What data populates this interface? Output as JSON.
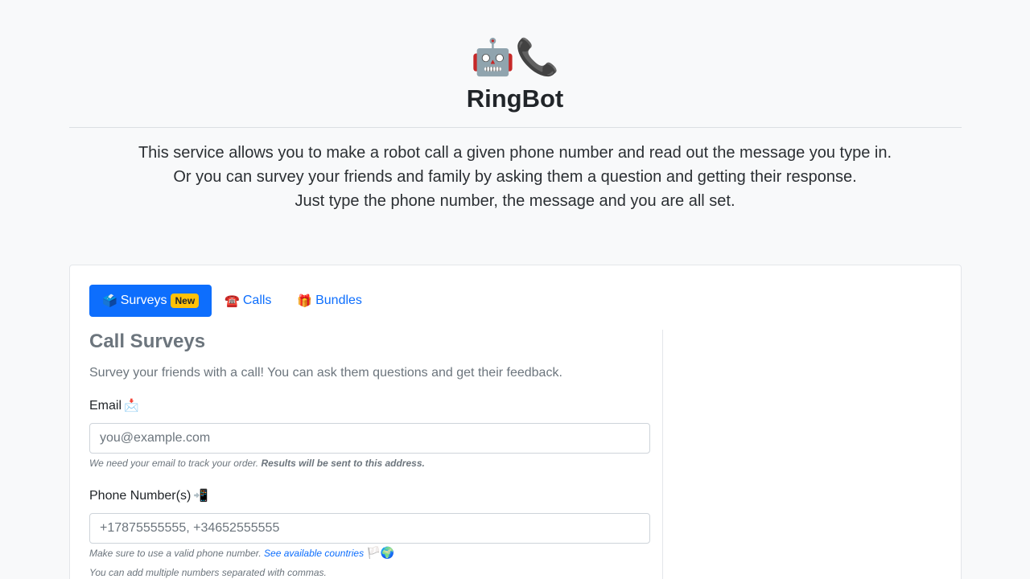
{
  "header": {
    "logo_emoji": "🤖📞",
    "title": "RingBot"
  },
  "intro": {
    "line1": "This service allows you to make a robot call a given phone number and read out the message you type in.",
    "line2": "Or you can survey your friends and family by asking them a question and getting their response.",
    "line3": "Just type the phone number, the message and you are all set."
  },
  "tabs": [
    {
      "icon": "🗳️",
      "label": "Surveys",
      "badge": "New",
      "active": true
    },
    {
      "icon": "☎️",
      "label": "Calls"
    },
    {
      "icon": "🎁",
      "label": "Bundles"
    }
  ],
  "form": {
    "title": "Call Surveys",
    "lead": "Survey your friends with a call! You can ask them questions and get their feedback.",
    "email": {
      "label": "Email",
      "emoji": "📩",
      "placeholder": "you@example.com",
      "help": "We need your email to track your order.",
      "help_bold": "Results will be sent to this address."
    },
    "phone": {
      "label": "Phone Number(s)",
      "emoji": "📲",
      "placeholder": "+17875555555, +34652555555",
      "help": "Make sure to use a valid phone number.",
      "help_link": "See available countries",
      "help_emoji": "🏳️🌍",
      "help2": "You can add multiple numbers separated with commas."
    }
  },
  "colors": {
    "accent": "#0d6efd",
    "badge": "#ffc107",
    "background": "#f8f9fa"
  }
}
